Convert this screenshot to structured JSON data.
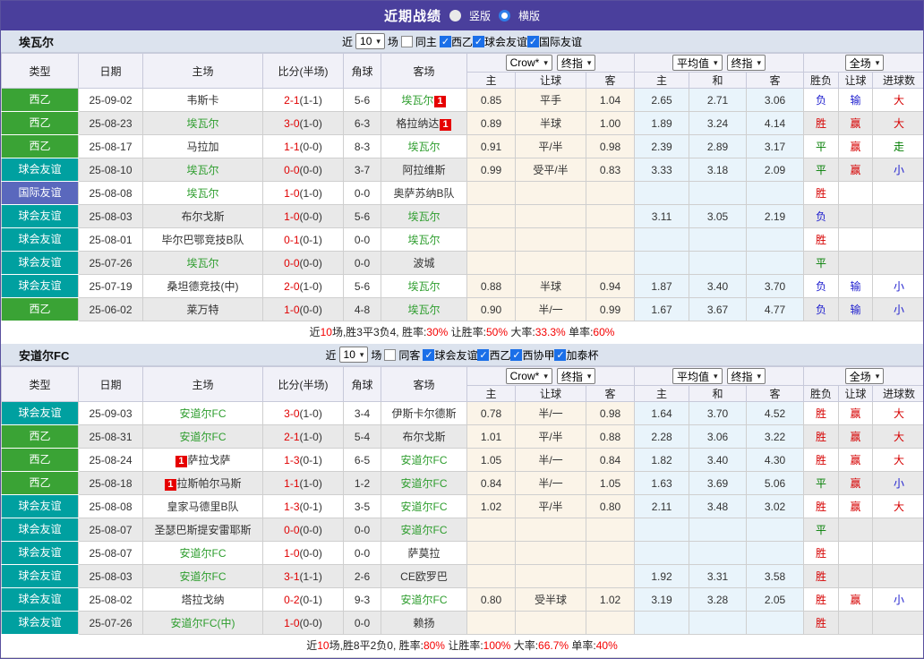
{
  "icons": {
    "dropdown": "▾",
    "check": "✓"
  },
  "colors": {
    "topbar": "#4a3f9c",
    "type_green": "#3aa335",
    "type_teal": "#00a0a0",
    "type_indigo": "#5a68bd",
    "team_highlight_green": "#2f9e2f",
    "score_red": "#e00000",
    "result_red": "#d60000",
    "result_green": "#007d00",
    "result_blue": "#1d1dce",
    "badge_red": "#e60000",
    "handicap_col_bg": "#fbf4e8",
    "average_col_bg": "#e9f4fb"
  },
  "header": {
    "title": "近期战绩",
    "radio_vertical": "竖版",
    "radio_horizontal": "横版",
    "selected": "横版"
  },
  "table_head": {
    "type": "类型",
    "date": "日期",
    "home": "主场",
    "score": "比分(半场)",
    "corner": "角球",
    "away": "客场",
    "sel_provider": "Crow*",
    "sel_final1": "终指",
    "sel_avg": "平均值",
    "sel_final2": "终指",
    "sel_fulltime": "全场",
    "h": "主",
    "handicap": "让球",
    "a": "客",
    "avg_h": "主",
    "avg_d": "和",
    "avg_a": "客",
    "wdl": "胜负",
    "hc": "让球",
    "goals": "进球数"
  },
  "sections": [
    {
      "team": "埃瓦尔",
      "filter": {
        "near": "近",
        "count": "10",
        "games": "场",
        "same": "同主",
        "same_checked": false,
        "leagues": [
          {
            "label": "西乙",
            "checked": true
          },
          {
            "label": "球会友谊",
            "checked": true
          },
          {
            "label": "国际友谊",
            "checked": true
          }
        ]
      },
      "rows": [
        {
          "type": "西乙",
          "tk": "tg",
          "date": "25-09-02",
          "home": {
            "n": "韦斯卡"
          },
          "ft": "2-1",
          "ht": "(1-1)",
          "corner": "5-6",
          "away": {
            "n": "埃瓦尔",
            "team": true,
            "badge": "1",
            "pos": "after"
          },
          "odds": [
            "0.85",
            "平手",
            "1.04"
          ],
          "avg": [
            "2.65",
            "2.71",
            "3.06"
          ],
          "res": [
            [
              "负",
              "b"
            ],
            [
              "输",
              "b"
            ],
            [
              "大",
              "r"
            ]
          ]
        },
        {
          "type": "西乙",
          "tk": "tg",
          "date": "25-08-23",
          "home": {
            "n": "埃瓦尔",
            "team": true
          },
          "ft": "3-0",
          "ht": "(1-0)",
          "corner": "6-3",
          "away": {
            "n": "格拉纳达",
            "badge": "1",
            "pos": "after"
          },
          "odds": [
            "0.89",
            "半球",
            "1.00"
          ],
          "avg": [
            "1.89",
            "3.24",
            "4.14"
          ],
          "res": [
            [
              "胜",
              "r"
            ],
            [
              "赢",
              "r"
            ],
            [
              "大",
              "r"
            ]
          ]
        },
        {
          "type": "西乙",
          "tk": "tg",
          "date": "25-08-17",
          "home": {
            "n": "马拉加"
          },
          "ft": "1-1",
          "ht": "(0-0)",
          "corner": "8-3",
          "away": {
            "n": "埃瓦尔",
            "team": true
          },
          "odds": [
            "0.91",
            "平/半",
            "0.98"
          ],
          "avg": [
            "2.39",
            "2.89",
            "3.17"
          ],
          "res": [
            [
              "平",
              "g"
            ],
            [
              "赢",
              "r"
            ],
            [
              "走",
              "g"
            ]
          ]
        },
        {
          "type": "球会友谊",
          "tk": "tt",
          "date": "25-08-10",
          "home": {
            "n": "埃瓦尔",
            "team": true
          },
          "ft": "0-0",
          "ht": "(0-0)",
          "corner": "3-7",
          "away": {
            "n": "阿拉维斯"
          },
          "odds": [
            "0.99",
            "受平/半",
            "0.83"
          ],
          "avg": [
            "3.33",
            "3.18",
            "2.09"
          ],
          "res": [
            [
              "平",
              "g"
            ],
            [
              "赢",
              "r"
            ],
            [
              "小",
              "b"
            ]
          ]
        },
        {
          "type": "国际友谊",
          "tk": "ti",
          "date": "25-08-08",
          "home": {
            "n": "埃瓦尔",
            "team": true
          },
          "ft": "1-0",
          "ht": "(1-0)",
          "corner": "0-0",
          "away": {
            "n": "奥萨苏纳B队"
          },
          "odds": [
            "",
            "",
            ""
          ],
          "avg": [
            "",
            "",
            ""
          ],
          "res": [
            [
              "胜",
              "r"
            ],
            [
              "",
              ""
            ],
            [
              "",
              ""
            ]
          ]
        },
        {
          "type": "球会友谊",
          "tk": "tt",
          "date": "25-08-03",
          "home": {
            "n": "布尔戈斯"
          },
          "ft": "1-0",
          "ht": "(0-0)",
          "corner": "5-6",
          "away": {
            "n": "埃瓦尔",
            "team": true
          },
          "odds": [
            "",
            "",
            ""
          ],
          "avg": [
            "3.11",
            "3.05",
            "2.19"
          ],
          "res": [
            [
              "负",
              "b"
            ],
            [
              "",
              ""
            ],
            [
              "",
              ""
            ]
          ]
        },
        {
          "type": "球会友谊",
          "tk": "tt",
          "date": "25-08-01",
          "home": {
            "n": "毕尔巴鄂竞技B队"
          },
          "ft": "0-1",
          "ht": "(0-1)",
          "corner": "0-0",
          "away": {
            "n": "埃瓦尔",
            "team": true
          },
          "odds": [
            "",
            "",
            ""
          ],
          "avg": [
            "",
            "",
            ""
          ],
          "res": [
            [
              "胜",
              "r"
            ],
            [
              "",
              ""
            ],
            [
              "",
              ""
            ]
          ]
        },
        {
          "type": "球会友谊",
          "tk": "tt",
          "date": "25-07-26",
          "home": {
            "n": "埃瓦尔",
            "team": true
          },
          "ft": "0-0",
          "ht": "(0-0)",
          "corner": "0-0",
          "away": {
            "n": "波城"
          },
          "odds": [
            "",
            "",
            ""
          ],
          "avg": [
            "",
            "",
            ""
          ],
          "res": [
            [
              "平",
              "g"
            ],
            [
              "",
              ""
            ],
            [
              "",
              ""
            ]
          ]
        },
        {
          "type": "球会友谊",
          "tk": "tt",
          "date": "25-07-19",
          "home": {
            "n": "桑坦德竞技(中)"
          },
          "ft": "2-0",
          "ht": "(1-0)",
          "corner": "5-6",
          "away": {
            "n": "埃瓦尔",
            "team": true
          },
          "odds": [
            "0.88",
            "半球",
            "0.94"
          ],
          "avg": [
            "1.87",
            "3.40",
            "3.70"
          ],
          "res": [
            [
              "负",
              "b"
            ],
            [
              "输",
              "b"
            ],
            [
              "小",
              "b"
            ]
          ]
        },
        {
          "type": "西乙",
          "tk": "tg",
          "date": "25-06-02",
          "home": {
            "n": "莱万特"
          },
          "ft": "1-0",
          "ht": "(0-0)",
          "corner": "4-8",
          "away": {
            "n": "埃瓦尔",
            "team": true
          },
          "odds": [
            "0.90",
            "半/一",
            "0.99"
          ],
          "avg": [
            "1.67",
            "3.67",
            "4.77"
          ],
          "res": [
            [
              "负",
              "b"
            ],
            [
              "输",
              "b"
            ],
            [
              "小",
              "b"
            ]
          ]
        }
      ],
      "summary": [
        {
          "t": "近"
        },
        {
          "t": "10",
          "red": true
        },
        {
          "t": "场,胜3平3负4, 胜率:"
        },
        {
          "t": "30%",
          "red": true
        },
        {
          "t": " 让胜率:"
        },
        {
          "t": "50%",
          "red": true
        },
        {
          "t": " 大率:"
        },
        {
          "t": "33.3%",
          "red": true
        },
        {
          "t": " 单率:"
        },
        {
          "t": "60%",
          "red": true
        }
      ]
    },
    {
      "team": "安道尔FC",
      "filter": {
        "near": "近",
        "count": "10",
        "games": "场",
        "same": "同客",
        "same_checked": false,
        "leagues": [
          {
            "label": "球会友谊",
            "checked": true
          },
          {
            "label": "西乙",
            "checked": true
          },
          {
            "label": "西协甲",
            "checked": true
          },
          {
            "label": "加泰杯",
            "checked": true
          }
        ]
      },
      "rows": [
        {
          "type": "球会友谊",
          "tk": "tt",
          "date": "25-09-03",
          "home": {
            "n": "安道尔FC",
            "team": true
          },
          "ft": "3-0",
          "ht": "(1-0)",
          "corner": "3-4",
          "away": {
            "n": "伊斯卡尔德斯"
          },
          "odds": [
            "0.78",
            "半/一",
            "0.98"
          ],
          "avg": [
            "1.64",
            "3.70",
            "4.52"
          ],
          "res": [
            [
              "胜",
              "r"
            ],
            [
              "赢",
              "r"
            ],
            [
              "大",
              "r"
            ]
          ]
        },
        {
          "type": "西乙",
          "tk": "tg",
          "date": "25-08-31",
          "home": {
            "n": "安道尔FC",
            "team": true
          },
          "ft": "2-1",
          "ht": "(1-0)",
          "corner": "5-4",
          "away": {
            "n": "布尔戈斯"
          },
          "odds": [
            "1.01",
            "平/半",
            "0.88"
          ],
          "avg": [
            "2.28",
            "3.06",
            "3.22"
          ],
          "res": [
            [
              "胜",
              "r"
            ],
            [
              "赢",
              "r"
            ],
            [
              "大",
              "r"
            ]
          ]
        },
        {
          "type": "西乙",
          "tk": "tg",
          "date": "25-08-24",
          "home": {
            "n": "萨拉戈萨",
            "badge": "1",
            "pos": "before"
          },
          "ft": "1-3",
          "ht": "(0-1)",
          "corner": "6-5",
          "away": {
            "n": "安道尔FC",
            "team": true
          },
          "odds": [
            "1.05",
            "半/一",
            "0.84"
          ],
          "avg": [
            "1.82",
            "3.40",
            "4.30"
          ],
          "res": [
            [
              "胜",
              "r"
            ],
            [
              "赢",
              "r"
            ],
            [
              "大",
              "r"
            ]
          ]
        },
        {
          "type": "西乙",
          "tk": "tg",
          "date": "25-08-18",
          "home": {
            "n": "拉斯帕尔马斯",
            "badge": "1",
            "pos": "before"
          },
          "ft": "1-1",
          "ht": "(1-0)",
          "corner": "1-2",
          "away": {
            "n": "安道尔FC",
            "team": true
          },
          "odds": [
            "0.84",
            "半/一",
            "1.05"
          ],
          "avg": [
            "1.63",
            "3.69",
            "5.06"
          ],
          "res": [
            [
              "平",
              "g"
            ],
            [
              "赢",
              "r"
            ],
            [
              "小",
              "b"
            ]
          ]
        },
        {
          "type": "球会友谊",
          "tk": "tt",
          "date": "25-08-08",
          "home": {
            "n": "皇家马德里B队"
          },
          "ft": "1-3",
          "ht": "(0-1)",
          "corner": "3-5",
          "away": {
            "n": "安道尔FC",
            "team": true
          },
          "odds": [
            "1.02",
            "平/半",
            "0.80"
          ],
          "avg": [
            "2.11",
            "3.48",
            "3.02"
          ],
          "res": [
            [
              "胜",
              "r"
            ],
            [
              "赢",
              "r"
            ],
            [
              "大",
              "r"
            ]
          ]
        },
        {
          "type": "球会友谊",
          "tk": "tt",
          "date": "25-08-07",
          "home": {
            "n": "圣瑟巴斯提安雷耶斯"
          },
          "ft": "0-0",
          "ht": "(0-0)",
          "corner": "0-0",
          "away": {
            "n": "安道尔FC",
            "team": true
          },
          "odds": [
            "",
            "",
            ""
          ],
          "avg": [
            "",
            "",
            ""
          ],
          "res": [
            [
              "平",
              "g"
            ],
            [
              "",
              ""
            ],
            [
              "",
              ""
            ]
          ]
        },
        {
          "type": "球会友谊",
          "tk": "tt",
          "date": "25-08-07",
          "home": {
            "n": "安道尔FC",
            "team": true
          },
          "ft": "1-0",
          "ht": "(0-0)",
          "corner": "0-0",
          "away": {
            "n": "萨莫拉"
          },
          "odds": [
            "",
            "",
            ""
          ],
          "avg": [
            "",
            "",
            ""
          ],
          "res": [
            [
              "胜",
              "r"
            ],
            [
              "",
              ""
            ],
            [
              "",
              ""
            ]
          ]
        },
        {
          "type": "球会友谊",
          "tk": "tt",
          "date": "25-08-03",
          "home": {
            "n": "安道尔FC",
            "team": true
          },
          "ft": "3-1",
          "ht": "(1-1)",
          "corner": "2-6",
          "away": {
            "n": "CE欧罗巴"
          },
          "odds": [
            "",
            "",
            ""
          ],
          "avg": [
            "1.92",
            "3.31",
            "3.58"
          ],
          "res": [
            [
              "胜",
              "r"
            ],
            [
              "",
              ""
            ],
            [
              "",
              ""
            ]
          ]
        },
        {
          "type": "球会友谊",
          "tk": "tt",
          "date": "25-08-02",
          "home": {
            "n": "塔拉戈纳"
          },
          "ft": "0-2",
          "ht": "(0-1)",
          "corner": "9-3",
          "away": {
            "n": "安道尔FC",
            "team": true
          },
          "odds": [
            "0.80",
            "受半球",
            "1.02"
          ],
          "avg": [
            "3.19",
            "3.28",
            "2.05"
          ],
          "res": [
            [
              "胜",
              "r"
            ],
            [
              "赢",
              "r"
            ],
            [
              "小",
              "b"
            ]
          ]
        },
        {
          "type": "球会友谊",
          "tk": "tt",
          "date": "25-07-26",
          "home": {
            "n": "安道尔FC(中)",
            "team": true
          },
          "ft": "1-0",
          "ht": "(0-0)",
          "corner": "0-0",
          "away": {
            "n": "赖扬"
          },
          "odds": [
            "",
            "",
            ""
          ],
          "avg": [
            "",
            "",
            ""
          ],
          "res": [
            [
              "胜",
              "r"
            ],
            [
              "",
              ""
            ],
            [
              "",
              ""
            ]
          ]
        }
      ],
      "summary": [
        {
          "t": "近"
        },
        {
          "t": "10",
          "red": true
        },
        {
          "t": "场,胜8平2负0, 胜率:"
        },
        {
          "t": "80%",
          "red": true
        },
        {
          "t": " 让胜率:"
        },
        {
          "t": "100%",
          "red": true
        },
        {
          "t": " 大率:"
        },
        {
          "t": "66.7%",
          "red": true
        },
        {
          "t": " 单率:"
        },
        {
          "t": "40%",
          "red": true
        }
      ]
    }
  ]
}
